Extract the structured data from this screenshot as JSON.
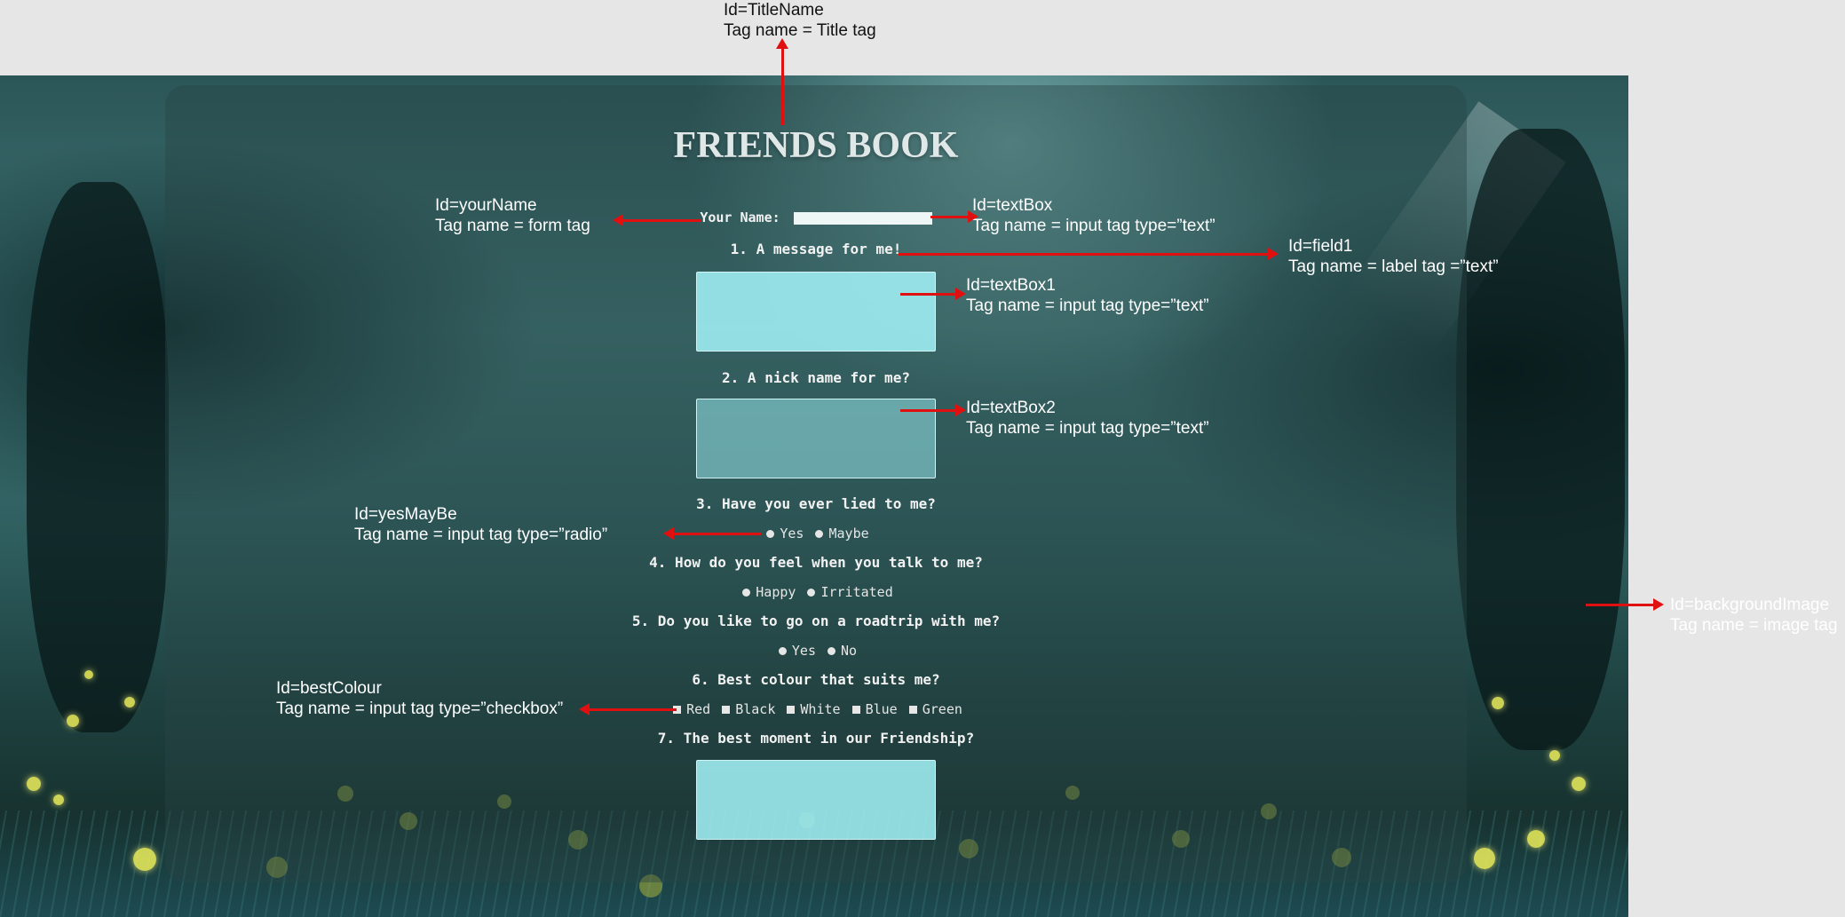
{
  "form": {
    "title": "FRIENDS BOOK",
    "your_name_label": "Your Name:",
    "q1": "1. A message for me!",
    "q2": "2. A nick name for me?",
    "q3": "3. Have you ever lied to me?",
    "q3_options": [
      "Yes",
      "Maybe"
    ],
    "q4": "4. How do you feel when you talk to me?",
    "q4_options": [
      "Happy",
      "Irritated"
    ],
    "q5": "5. Do you like to go on a roadtrip with me?",
    "q5_options": [
      "Yes",
      "No"
    ],
    "q6": "6. Best colour that suits me?",
    "q6_options": [
      "Red",
      "Black",
      "White",
      "Blue",
      "Green"
    ],
    "q7": "7. The best moment in our Friendship?"
  },
  "annotations": {
    "title": {
      "id": "Id=TitleName",
      "tag": "Tag name = Title tag"
    },
    "your_name": {
      "id": "Id=yourName",
      "tag": "Tag name = form tag"
    },
    "text_box": {
      "id": "Id=textBox",
      "tag": "Tag name = input tag type=”text”"
    },
    "field1": {
      "id": "Id=field1",
      "tag": "Tag name = label tag =”text”"
    },
    "text_box1": {
      "id": "Id=textBox1",
      "tag": "Tag name = input tag type=”text”"
    },
    "text_box2": {
      "id": "Id=textBox2",
      "tag": "Tag name = input tag type=”text”"
    },
    "yes_maybe": {
      "id": "Id=yesMayBe",
      "tag": "Tag name = input tag type=”radio”"
    },
    "background": {
      "id": "Id=backgroundImage",
      "tag": "Tag name = image tag"
    },
    "best_colour": {
      "id": "Id=bestColour",
      "tag": "Tag name = input tag type=”checkbox”"
    }
  },
  "colors": {
    "arrow": "#e01010",
    "textarea": "#a0f0f5",
    "card": "#284646"
  }
}
